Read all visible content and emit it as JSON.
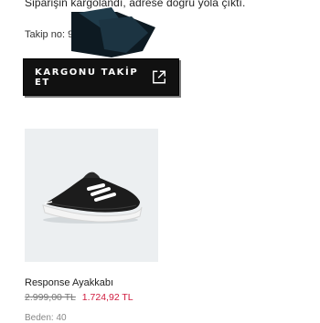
{
  "order": {
    "status_message": "Siparişin kargolandı, adrese doğru yola çıktı.",
    "tracking_label": "Takip no: 9",
    "track_button_label": "KARGONU TAKİP ET",
    "track_button_icon": "external-link-icon"
  },
  "product": {
    "image_icon": "running-shoe-image",
    "name": "Response Ayakkabı",
    "old_price": "2.999,00 TL",
    "new_price": "1.724,92 TL",
    "size": "Beden: 40"
  },
  "colors": {
    "button_bg": "#111111",
    "sale_price": "#d01c3f",
    "card_bg": "#eceff1"
  }
}
